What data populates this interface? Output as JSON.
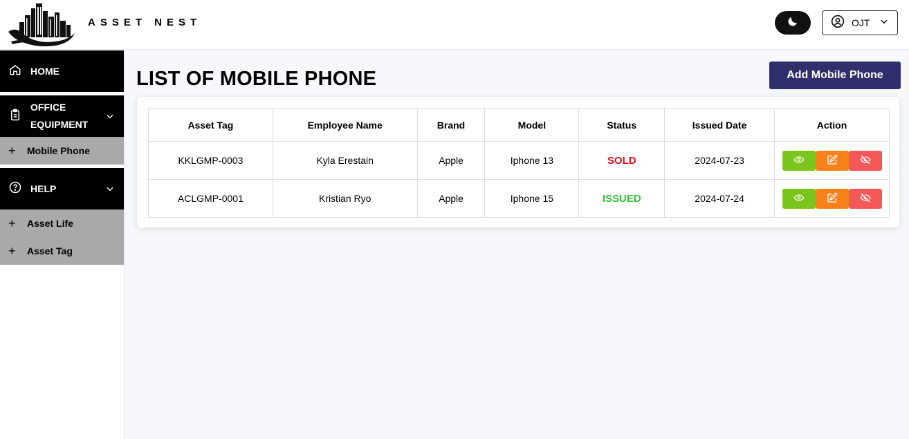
{
  "header": {
    "brand": "ASSET NEST",
    "user": {
      "name": "OJT"
    }
  },
  "sidebar": {
    "home": "HOME",
    "office_equipment": [
      "OFFICE",
      "EQUIPMENT"
    ],
    "mobile_phone": "Mobile Phone",
    "help": "HELP",
    "asset_life": "Asset Life",
    "asset_tag": "Asset Tag"
  },
  "main": {
    "title": "LIST OF MOBILE PHONE",
    "add_button": "Add Mobile Phone",
    "table": {
      "columns": [
        "Asset Tag",
        "Employee Name",
        "Brand",
        "Model",
        "Status",
        "Issued Date",
        "Action"
      ],
      "rows": [
        {
          "asset_tag": "KKLGMP-0003",
          "employee": "Kyla Erestain",
          "brand": "Apple",
          "model": "Iphone 13",
          "status": "SOLD",
          "issued_date": "2024-07-23"
        },
        {
          "asset_tag": "ACLGMP-0001",
          "employee": "Kristian Ryo",
          "brand": "Apple",
          "model": "Iphone 15",
          "status": "ISSUED",
          "issued_date": "2024-07-24"
        }
      ]
    }
  },
  "colors": {
    "sidebar_main": "#000000",
    "sidebar_sub": "#a9a9a9",
    "add_button": "#2e2f6b",
    "status_sold": "#e00d1a",
    "status_issued": "#2fc13c",
    "view_button": "#7cc51c",
    "edit_button": "#f7821b",
    "hide_button": "#f45858"
  },
  "icons": [
    "logo-skyline",
    "moon-icon",
    "user-circle-icon",
    "chevron-down-icon",
    "home-icon",
    "clipboard-icon",
    "help-circle-icon",
    "plus-icon",
    "eye-icon",
    "edit-icon",
    "eye-off-icon"
  ]
}
